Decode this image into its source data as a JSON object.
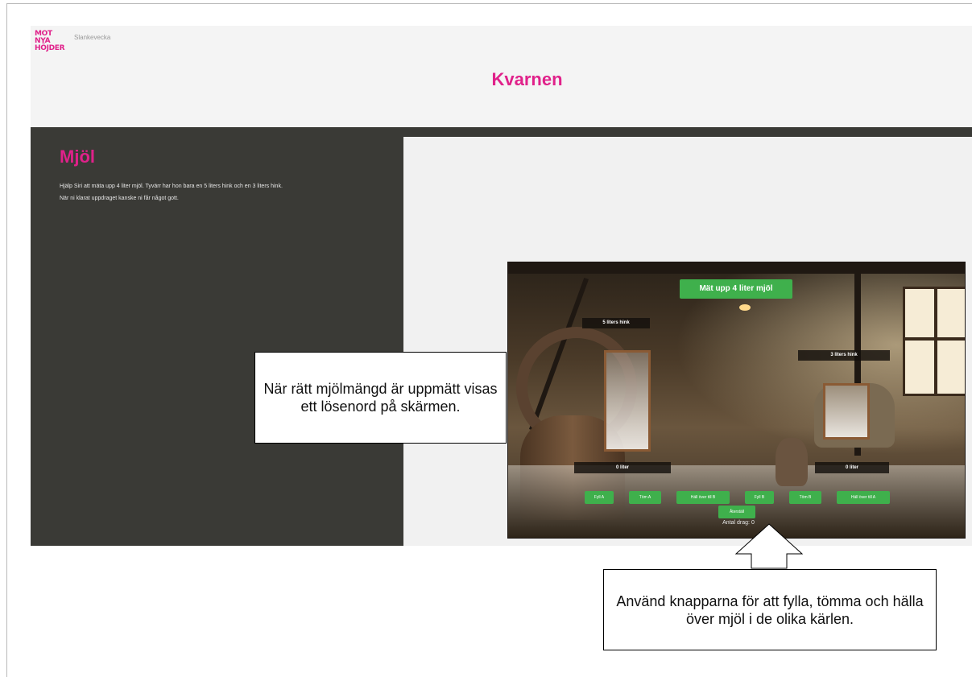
{
  "header": {
    "logo_line1": "MOT NYA",
    "logo_line2": "HÖJDER",
    "subtitle": "Slankevecka",
    "title": "Kvarnen",
    "brand_color": "#e0218a"
  },
  "left_panel": {
    "title": "Mjöl",
    "paragraph1": "Hjälp Siri att mäta upp 4 liter mjöl. Tyvärr har hon bara en 5 liters hink och en 3 liters hink.",
    "paragraph2": "När ni klarat uppdraget kanske ni får något gott."
  },
  "game": {
    "goal": "Mät upp 4 liter mjöl",
    "bucket_a": {
      "label": "5 liters hink",
      "level": "0 liter"
    },
    "bucket_b": {
      "label": "3 liters hink",
      "level": "0 liter"
    },
    "buttons_a": [
      "Fyll A",
      "Töm A",
      "Häll över till B"
    ],
    "buttons_b": [
      "Fyll B",
      "Töm B",
      "Häll över till A"
    ],
    "reset": "Återställ",
    "moves": "Antal drag: 0",
    "accent_color": "#3fb04c"
  },
  "callouts": {
    "password": "När rätt mjölmängd är uppmätt visas ett lösenord på skärmen.",
    "buttons": "Använd knapparna för att fylla, tömma och hälla över mjöl i de olika kärlen."
  }
}
